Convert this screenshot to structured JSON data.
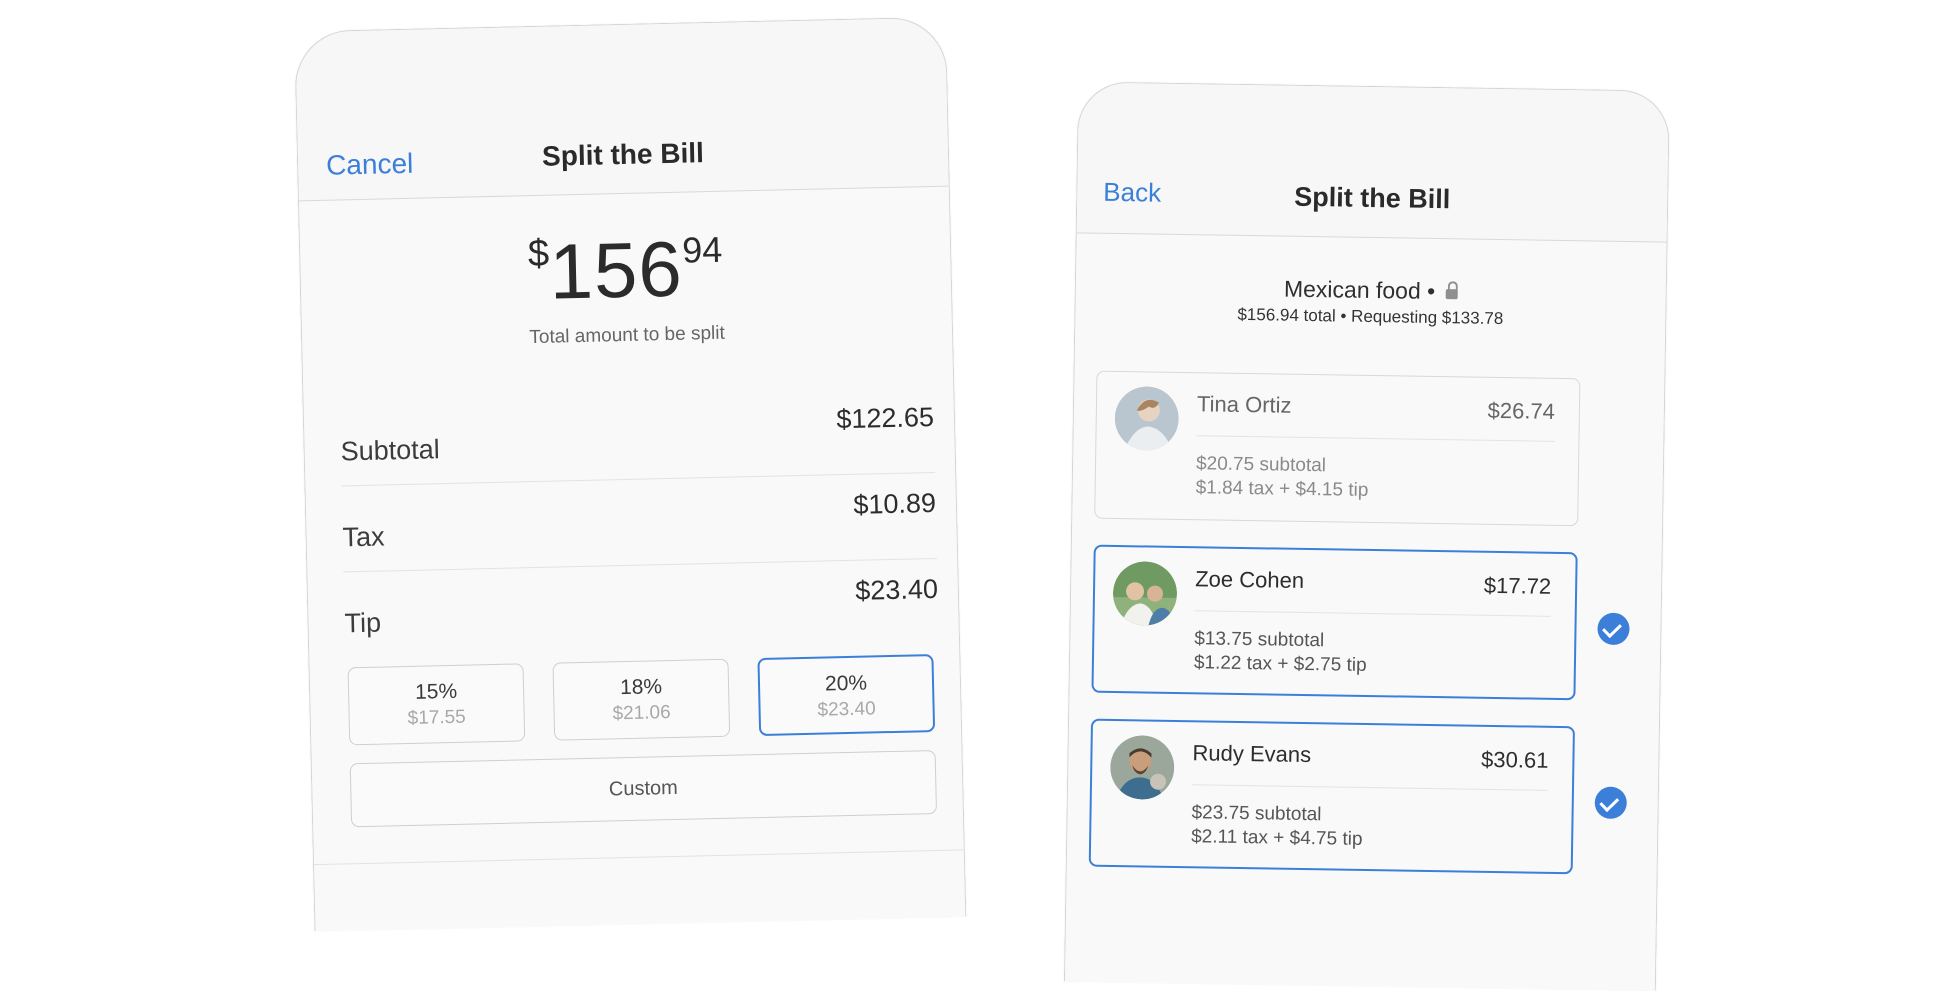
{
  "left_screen": {
    "cancel_label": "Cancel",
    "title": "Split the Bill",
    "total": {
      "currency": "$",
      "whole": "156",
      "cents": "94",
      "caption": "Total amount to be split"
    },
    "rows": {
      "subtotal": {
        "label": "Subtotal",
        "value": "$122.65"
      },
      "tax": {
        "label": "Tax",
        "value": "$10.89"
      },
      "tip": {
        "label": "Tip",
        "value": "$23.40"
      }
    },
    "tip_options": [
      {
        "percent": "15%",
        "amount": "$17.55"
      },
      {
        "percent": "18%",
        "amount": "$21.06"
      },
      {
        "percent": "20%",
        "amount": "$23.40",
        "selected": true
      }
    ],
    "custom_label": "Custom"
  },
  "right_screen": {
    "back_label": "Back",
    "title": "Split the Bill",
    "bill_name": "Mexican food •",
    "bill_summary": "$156.94 total • Requesting $133.78",
    "people": [
      {
        "name": "Tina Ortiz",
        "amount": "$26.74",
        "line1": "$20.75 subtotal",
        "line2": "$1.84 tax + $4.15 tip",
        "selected": false
      },
      {
        "name": "Zoe Cohen",
        "amount": "$17.72",
        "line1": "$13.75 subtotal",
        "line2": "$1.22 tax + $2.75 tip",
        "selected": true
      },
      {
        "name": "Rudy Evans",
        "amount": "$30.61",
        "line1": "$23.75 subtotal",
        "line2": "$2.11 tax + $4.75 tip",
        "selected": true
      }
    ]
  },
  "colors": {
    "accent": "#3b7fd8",
    "background": "#ffffff",
    "card": "#f9f9f9"
  },
  "icons": {
    "lock": "lock-icon",
    "check": "checkmark-circle-icon"
  }
}
